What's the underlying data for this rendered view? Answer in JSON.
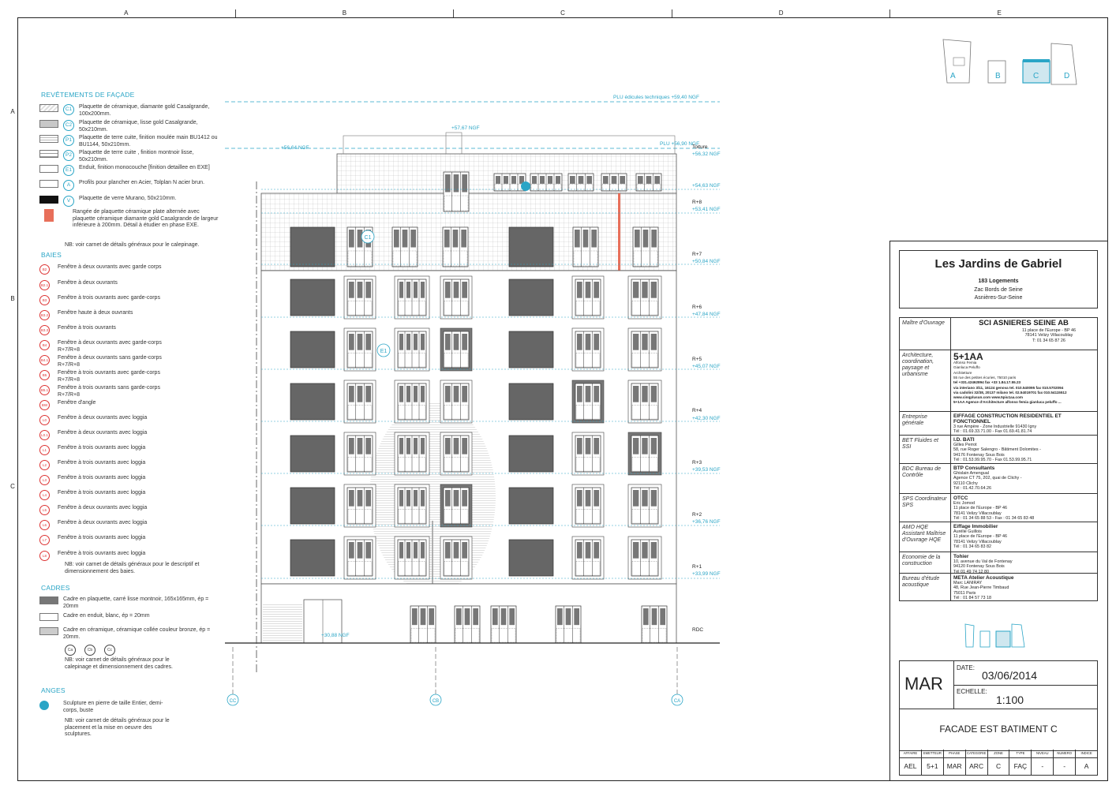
{
  "columns": [
    "A",
    "B",
    "C",
    "D",
    "E"
  ],
  "rows": [
    "A",
    "B",
    "C"
  ],
  "legend": {
    "facade_title": "REVÊTEMENTS DE FAÇADE",
    "facade_items": [
      {
        "tag": "C1",
        "text": "Plaquette de céramique, diamante gold Casalgrande, 100x200mm."
      },
      {
        "tag": "C2",
        "text": "Plaquette de céramique, lisse gold Casalgrande, 50x210mm."
      },
      {
        "tag": "P1",
        "text": "Plaquette de terre cuite, finition moulée main BU1412 ou BU1144, 50x210mm."
      },
      {
        "tag": "P2",
        "text": "Plaquette de terre cuite , finition montnoir lisse, 50x210mm."
      },
      {
        "tag": "E1",
        "text": "Enduit, finition monocouche [finition detaillee en EXE]"
      },
      {
        "tag": "A",
        "text": "Profils pour plancher en Acier, Tolplan N acier brun."
      },
      {
        "tag": "V",
        "text": "Plaquette de verre Murano, 50x210mm."
      },
      {
        "tag": "",
        "text": "Rangée de plaquette céramique plate alternée avec plaquette céramique diamante gold Casalgrande de largeur inférieure à 200mm. Détail à étudier en phase EXE."
      }
    ],
    "facade_note": "NB: voir carnet de détails généraux pour le calepinage.",
    "baies_title": "BAIES",
    "baies_items": [
      {
        "tag": "B2",
        "text": "Fenêtre à deux ouvrants avec garde corps"
      },
      {
        "tag": "B2.1",
        "text": "Fenêtre à deux ouvrants"
      },
      {
        "tag": "B3",
        "text": "Fenêtre à trois ouvrants avec garde-corps"
      },
      {
        "tag": "B3.2",
        "text": "Fenêtre haute à deux ouvrants"
      },
      {
        "tag": "B3.3",
        "text": "Fenêtre à trois ouvrants"
      },
      {
        "tag": "B4",
        "text": "Fenêtre à deux ouvrants avec garde-corps R+7/R+8"
      },
      {
        "tag": "B4.1",
        "text": "Fenêtre à deux ouvrants sans garde-corps R+7/R+8"
      },
      {
        "tag": "B5",
        "text": "Fenêtre à trois ouvrants avec garde-corps R+7/R+8"
      },
      {
        "tag": "B5.1",
        "text": "Fenêtre à trois ouvrants sans garde-corps R+7/R+8"
      },
      {
        "tag": "BW",
        "text": "Fenêtre d'angle"
      },
      {
        "tag": "L0",
        "text": "Fenêtre à deux ouvrants avec loggia"
      },
      {
        "tag": "L0.1",
        "text": "Fenêtre à deux ouvrants avec loggia"
      },
      {
        "tag": "L1",
        "text": "Fenêtre à trois ouvrants avec loggia"
      },
      {
        "tag": "L2",
        "text": "Fenêtre à trois ouvrants avec loggia"
      },
      {
        "tag": "L3",
        "text": "Fenêtre à trois ouvrants avec loggia"
      },
      {
        "tag": "L4",
        "text": "Fenêtre à trois ouvrants avec loggia"
      },
      {
        "tag": "L5",
        "text": "Fenêtre à deux ouvrants avec loggia"
      },
      {
        "tag": "L6",
        "text": "Fenêtre à deux ouvrants avec loggia"
      },
      {
        "tag": "L7",
        "text": "Fenêtre à trois ouvrants avec loggia"
      },
      {
        "tag": "L8",
        "text": "Fenêtre à trois ouvrants avec loggia"
      }
    ],
    "baies_note": "NB: voir carnet de détails généraux pour le descriptif et dimensionnement des baies.",
    "cadres_title": "CADRES",
    "cadres_items": [
      {
        "text": "Cadre en plaquette, carré lisse montnoir, 165x165mm, ép = 20mm"
      },
      {
        "text": "Cadre en enduit, blanc, ép = 20mm"
      },
      {
        "text": "Cadre en céramique, céramique collée couleur bronze, ép = 20mm."
      }
    ],
    "cadres_tags": [
      "Ca",
      "Cb",
      "Cc"
    ],
    "cadres_note": "NB: voir carnet de détails généraux pour le calepinage et dimensionnement des cadres.",
    "anges_title": "ANGES",
    "anges_item": "Sculpture en pierre de taille Entier, demi-corps, buste",
    "anges_note": "NB: voir carnet de détails généraux pour le placement et la mise en oeuvre des sculptures."
  },
  "elevation": {
    "plu_top": "PLU édicules techniques +59,40 NGF",
    "plu_main": "PLU +56,90 NGF",
    "lvl_5767": "+57,67 NGF",
    "lvl_5664": "+56,64 NGF",
    "toiture": "Toiture",
    "lvl_5632": "+56,32 NGF",
    "lvl_5463": "+54,63 NGF",
    "r8": "R+8",
    "lvl_5341": "+53,41 NGF",
    "r7": "R+7",
    "lvl_5084": "+50,84 NGF",
    "r6": "R+6",
    "lvl_4784": "+47,84 NGF",
    "r5": "R+5",
    "lvl_4507": "+45,07 NGF",
    "r4": "R+4",
    "lvl_4230": "+42,30 NGF",
    "r3": "R+3",
    "lvl_3953": "+39,53 NGF",
    "r2": "R+2",
    "lvl_3676": "+36,76 NGF",
    "r1": "R+1",
    "lvl_3399": "+33,99 NGF",
    "rdc": "RDC",
    "lvl_3088": "+30,88 NGF",
    "tag_c1": "C1",
    "tag_e1": "E1",
    "axes": [
      "CC",
      "CB",
      "CA"
    ]
  },
  "keyplan": {
    "labels": [
      "A",
      "B",
      "C",
      "D"
    ]
  },
  "title_block": {
    "project": "Les Jardins de Gabriel",
    "logements": "183 Logements",
    "zac": "Zac Bords de Seine",
    "city": "Asnières-Sur-Seine",
    "rows": [
      {
        "role": "Maître d'Ouvrage",
        "name": "SCI ASNIERES SEINE AB",
        "lines": [
          "11 place de l'Europe - BP 46",
          "78141 Velizy Villacoublay",
          "T: 01 34 65 87 26"
        ]
      },
      {
        "role": "Architecture, coordination, paysage et urbanisme",
        "name": "5+1AA",
        "lines": [
          "Alfonso Femia",
          "Gianluca Peluffo",
          "Architetture",
          "55 rue des petites écuries, 75010 paris",
          "tel +331.42462894 fax +33 1.84.17.55.23",
          "via interiano 3/11, 16124 genova tel. 010.540095 fax 010.5702094",
          "via cadolini 32/38, 20137 milano tel. 02.54019701 fax 010.54115512",
          "www.cinqplusun.com   www.5piu1aa.com",
          "5+1AA Agence d'Architecture alfonso femia gianluca peluffo ..."
        ]
      },
      {
        "role": "Entreprise générale",
        "name": "EIFFAGE CONSTRUCTION RESIDENTIEL ET FONCTIONNEL",
        "lines": [
          "3 rue Ampère - Zone Industrielle 91430 Igny",
          "Tél : 01.69.33.71.00 - Fax 01.69.41.81.74"
        ]
      },
      {
        "role": "BET Fluides et SSI",
        "name": "I.D. BATI",
        "lines": [
          "Gilles Perrot",
          "58, rue Roger Salengro - Bâtiment Dolomites -",
          "94176 Fontenay Sous Bois",
          "Tél : 01.53.99.95.70 - Fax 01.53.99.95.71"
        ]
      },
      {
        "role": "BDC Bureau de Contrôle",
        "name": "BTP Consultants",
        "lines": [
          "Ghislain Amengual",
          "Agence CT 75, 202, quai de Clichy -",
          "92110 Clichy",
          "Tél : 01.42.70.64.26"
        ]
      },
      {
        "role": "SPS Coordinateur SPS",
        "name": "OTCC",
        "lines": [
          "Eric Jomod",
          "11 place de l'Europe - BP 46",
          "78141 Velizy Villacoublay",
          "Tél : 01 34 65 88 53 - Fax : 01 34 65 83 48"
        ]
      },
      {
        "role": "AMO HQE Assistant Maîtrise d'Ouvrage HQE",
        "name": "Eiffage Immobilier",
        "lines": [
          "Aurélie Guillois",
          "11 place de l'Europe - BP 46",
          "78141 Velizy Villacoublay",
          "Tél : 01 34 65 83 82"
        ]
      },
      {
        "role": "Economie de la construction",
        "name": "Tohier",
        "lines": [
          "10, avenue du Val de Fontenay",
          "94120 Fontenay Sous Bois",
          "Tél 01 49 74 12 80"
        ]
      },
      {
        "role": "Bureau d'étude acoustique",
        "name": "META Atelier Acoustique",
        "lines": [
          "Marc LANIRAY",
          "48, Rue Jean-Pierre Timbaud",
          "75011 Paris",
          "Tél : 01 84 57 73 18"
        ]
      }
    ],
    "phase": "MAR",
    "date_label": "DATE:",
    "date": "03/06/2014",
    "scale_label": "ECHELLE:",
    "scale": "1:100",
    "sheet_title": "FACADE EST BATIMENT C",
    "codes_head": [
      "AFFAIRE",
      "EMETTEUR",
      "PHASE",
      "CATEGORIE",
      "ZONE",
      "TYPE",
      "NIVEAU",
      "NUMERO",
      "INDICE"
    ],
    "codes_vals": [
      "AEL",
      "5+1",
      "MAR",
      "ARC",
      "C",
      "FAÇ",
      "-",
      "-",
      "A"
    ]
  },
  "colors": {
    "accent": "#2aa5c6",
    "tag_red": "#d33",
    "window": "#666",
    "frame_dark": "#444"
  }
}
